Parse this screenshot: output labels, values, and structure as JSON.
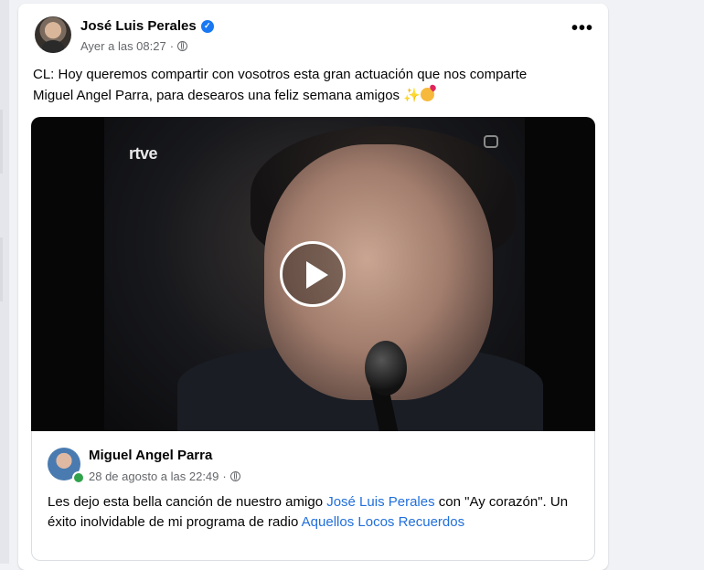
{
  "post": {
    "author": "José Luis Perales",
    "time": "Ayer a las 08:27",
    "more_label": "•••",
    "text_line1": "CL: Hoy queremos compartir con vosotros esta gran actuación que nos comparte",
    "text_line2": "Miguel Angel Parra, para desearos una feliz semana amigos",
    "emoji_sparkle": "✨"
  },
  "video": {
    "watermark": "rtve"
  },
  "shared_post": {
    "author": "Miguel Angel Parra",
    "time": "28 de agosto a las 22:49",
    "text_part1": "Les dejo esta bella canción de nuestro amigo ",
    "link_artist": "José Luis Perales",
    "text_part2": " con  \"Ay corazón\". Un éxito inolvidable de mi programa de radio ",
    "link_program": "Aquellos Locos Recuerdos"
  },
  "colors": {
    "link": "#216fdb",
    "verified": "#1877f2",
    "online": "#31a24c"
  },
  "icons": [
    "verified-icon",
    "globe-icon",
    "more-options-icon",
    "play-icon",
    "tv-logo-icon",
    "sparkles-emoji",
    "kiss-face-emoji"
  ]
}
